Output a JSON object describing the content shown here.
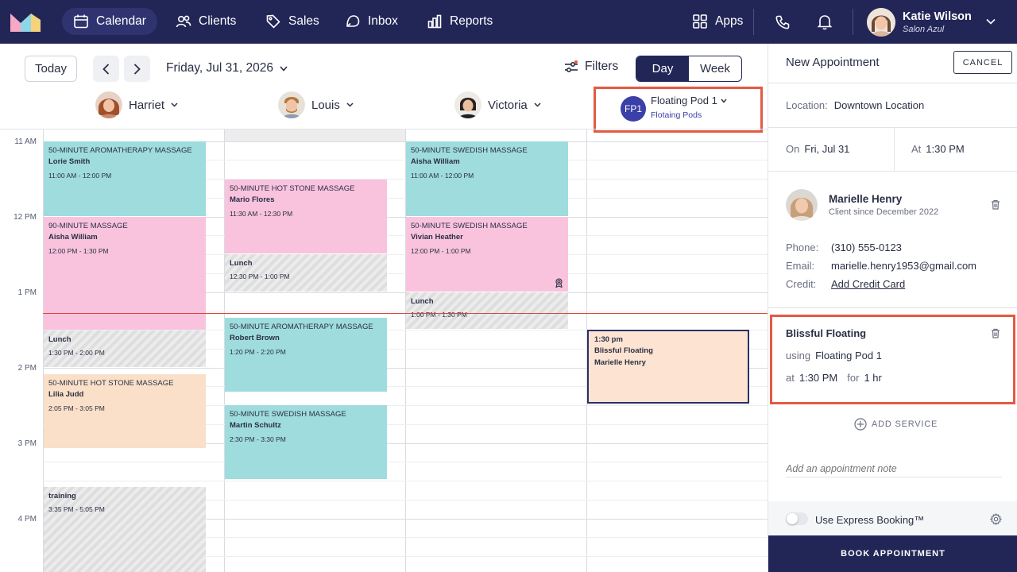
{
  "nav": {
    "items": [
      {
        "label": "Calendar",
        "icon": "calendar-icon",
        "active": true
      },
      {
        "label": "Clients",
        "icon": "users-icon"
      },
      {
        "label": "Sales",
        "icon": "tag-icon"
      },
      {
        "label": "Inbox",
        "icon": "inbox-icon"
      },
      {
        "label": "Reports",
        "icon": "bar-chart-icon"
      }
    ],
    "apps_label": "Apps",
    "user_name": "Katie Wilson",
    "user_business": "Salon Azul"
  },
  "toolbar": {
    "today_label": "Today",
    "date_label": "Friday, Jul 31, 2026",
    "filters_label": "Filters",
    "day_label": "Day",
    "week_label": "Week"
  },
  "staff": [
    {
      "name": "Harriet"
    },
    {
      "name": "Louis"
    },
    {
      "name": "Victoria"
    }
  ],
  "floating_pod": {
    "badge": "FP1",
    "name": "Floating Pod 1",
    "group": "Flotaing Pods"
  },
  "time_labels": [
    "11 AM",
    "12 PM",
    "1 PM",
    "2 PM",
    "3 PM",
    "4 PM"
  ],
  "events": {
    "harriet": [
      {
        "title": "50-MINUTE AROMATHERAPY MASSAGE",
        "name": "Lorie Smith",
        "time": "11:00 AM - 12:00 PM"
      },
      {
        "title": "90-MINUTE MASSAGE",
        "name": "Aisha William",
        "time": "12:00 PM - 1:30 PM"
      },
      {
        "name": "Lunch",
        "time": "1:30 PM - 2:00 PM"
      },
      {
        "title": "50-MINUTE HOT STONE MASSAGE",
        "name": "Lilia Judd",
        "time": "2:05 PM - 3:05 PM"
      },
      {
        "name": "training",
        "time": "3:35 PM - 5:05 PM"
      }
    ],
    "louis": [
      {
        "title": "50-MINUTE HOT STONE MASSAGE",
        "name": "Mario Flores",
        "time": "11:30 AM - 12:30 PM"
      },
      {
        "name": "Lunch",
        "time": "12:30 PM - 1:00 PM"
      },
      {
        "title": "50-MINUTE AROMATHERAPY MASSAGE",
        "name": "Robert Brown",
        "time": "1:20 PM - 2:20 PM"
      },
      {
        "title": "50-MINUTE SWEDISH MASSAGE",
        "name": "Martin Schultz",
        "time": "2:30 PM - 3:30 PM"
      }
    ],
    "victoria": [
      {
        "title": "50-MINUTE SWEDISH MASSAGE",
        "name": "Aisha William",
        "time": "11:00 AM - 12:00 PM"
      },
      {
        "title": "50-MINUTE SWEDISH MASSAGE",
        "name": "Vivian Heather",
        "time": "12:00 PM - 1:00 PM"
      },
      {
        "name": "Lunch",
        "time": "1:00 PM - 1:30 PM"
      }
    ],
    "pod": {
      "time": "1:30 pm",
      "service": "Blissful Floating",
      "client": "Marielle Henry"
    }
  },
  "panel": {
    "title": "New Appointment",
    "cancel_label": "CANCEL",
    "location_label": "Location:",
    "location_value": "Downtown Location",
    "on_label": "On",
    "on_value": "Fri, Jul 31",
    "at_label": "At",
    "at_value": "1:30 PM",
    "client_name": "Marielle Henry",
    "client_since": "Client since December 2022",
    "phone_label": "Phone:",
    "phone_value": "(310) 555-0123",
    "email_label": "Email:",
    "email_value": "marielle.henry1953@gmail.com",
    "credit_label": "Credit:",
    "credit_value": "Add Credit Card",
    "service_name": "Blissful Floating",
    "using_label": "using",
    "using_value": "Floating Pod 1",
    "svc_at_label": "at",
    "svc_at_value": "1:30 PM",
    "for_label": "for",
    "for_value": "1 hr",
    "add_service_label": "ADD SERVICE",
    "note_placeholder": "Add an appointment note",
    "express_label": "Use Express Booking™",
    "book_label": "BOOK APPOINTMENT"
  },
  "colors": {
    "nav_bg": "#222657",
    "teal": "#9fdcde",
    "pink": "#f9c3dd",
    "peach": "#fae0c8",
    "highlight": "#e35a42",
    "now_line": "#d8443a"
  }
}
